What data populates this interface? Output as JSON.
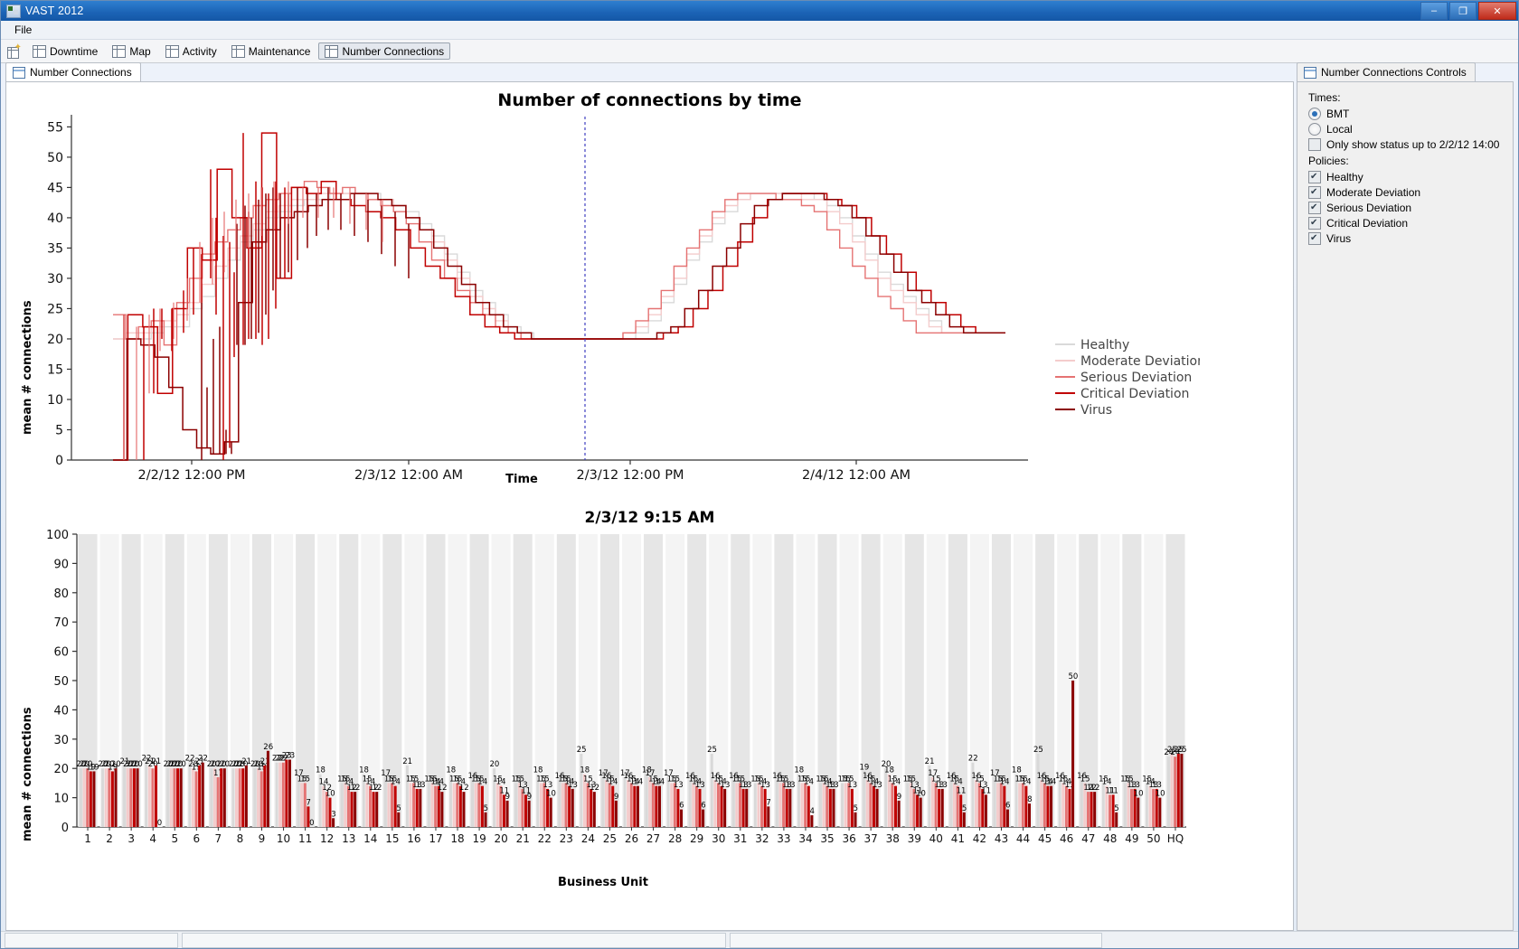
{
  "window": {
    "title": "VAST 2012",
    "title_ghost": "",
    "minimize": "–",
    "maximize": "❐",
    "close": "✕",
    "app_icon": "app-icon"
  },
  "menubar": {
    "items": [
      "File"
    ]
  },
  "perspectives": {
    "new_label": "",
    "items": [
      {
        "label": "Downtime",
        "active": false
      },
      {
        "label": "Map",
        "active": false
      },
      {
        "label": "Activity",
        "active": false
      },
      {
        "label": "Maintenance",
        "active": false
      },
      {
        "label": "Number Connections",
        "active": true
      }
    ]
  },
  "editor": {
    "tab_label": "Number Connections"
  },
  "controls_view": {
    "tab_label": "Number Connections Controls",
    "times_label": "Times:",
    "times_options": [
      {
        "label": "BMT",
        "selected": true
      },
      {
        "label": "Local",
        "selected": false
      }
    ],
    "only_show_label": "Only show status up to 2/2/12 14:00",
    "only_show_checked": false,
    "policies_label": "Policies:",
    "policies": [
      {
        "label": "Healthy",
        "checked": true,
        "color": "#d9d9d9"
      },
      {
        "label": "Moderate Deviation",
        "checked": true,
        "color": "#f2c4c4"
      },
      {
        "label": "Serious Deviation",
        "checked": true,
        "color": "#e08080"
      },
      {
        "label": "Critical Deviation",
        "checked": true,
        "color": "#e00000"
      },
      {
        "label": "Virus",
        "checked": true,
        "color": "#8b0000"
      }
    ]
  },
  "chart_data": [
    {
      "id": "connections_by_time",
      "type": "line",
      "title": "Number of connections by time",
      "xlabel": "Time",
      "ylabel": "mean # connections",
      "ylim": [
        0,
        57
      ],
      "yticks": [
        0,
        5,
        10,
        15,
        20,
        25,
        30,
        35,
        40,
        45,
        50,
        55
      ],
      "xticks": [
        "2/2/12 12:00 PM",
        "2/3/12 12:00 AM",
        "2/3/12 12:00 PM",
        "2/4/12 12:00 AM"
      ],
      "grid": false,
      "legend_position": "right",
      "marker_line": {
        "label": "2/3/12 9:15 AM",
        "color": "#4040c0",
        "style": "dashed"
      },
      "series": [
        {
          "name": "Healthy",
          "color": "#d9d9d9"
        },
        {
          "name": "Moderate Deviation",
          "color": "#f4cccc"
        },
        {
          "name": "Serious Deviation",
          "color": "#e57373"
        },
        {
          "name": "Critical Deviation",
          "color": "#c00000"
        },
        {
          "name": "Virus",
          "color": "#8b0000"
        }
      ],
      "series_values": {
        "Healthy": [
          20,
          20,
          20,
          21,
          22,
          22,
          25,
          27,
          30,
          33,
          36,
          38,
          40,
          41,
          42,
          43,
          43,
          44,
          44,
          44,
          44,
          43,
          42,
          41,
          39,
          37,
          34,
          31,
          28,
          26,
          24,
          22,
          21,
          20,
          20,
          20,
          20,
          20,
          20,
          20,
          20,
          21,
          23,
          26,
          29,
          33,
          36,
          39,
          41,
          43,
          44,
          44,
          44,
          44,
          44,
          43,
          42,
          40,
          37,
          34,
          31,
          29,
          27,
          25,
          23,
          21,
          21,
          21,
          21,
          21
        ],
        "Moderate Deviation": [
          20,
          21,
          21,
          22,
          23,
          24,
          26,
          29,
          32,
          35,
          37,
          39,
          41,
          42,
          43,
          43,
          44,
          44,
          44,
          44,
          43,
          43,
          42,
          40,
          38,
          36,
          33,
          30,
          27,
          25,
          23,
          21,
          20,
          20,
          20,
          20,
          20,
          20,
          20,
          20,
          21,
          22,
          24,
          27,
          30,
          34,
          37,
          40,
          42,
          43,
          44,
          44,
          44,
          44,
          43,
          43,
          41,
          39,
          36,
          33,
          30,
          28,
          26,
          24,
          22,
          21,
          21,
          21,
          21,
          21
        ],
        "Serious Deviation": [
          24,
          20,
          22,
          23,
          19,
          26,
          30,
          34,
          36,
          38,
          40,
          42,
          43,
          44,
          45,
          46,
          45,
          44,
          45,
          44,
          43,
          42,
          41,
          39,
          36,
          33,
          30,
          28,
          26,
          24,
          22,
          21,
          20,
          20,
          20,
          20,
          20,
          20,
          20,
          20,
          21,
          23,
          25,
          28,
          32,
          35,
          38,
          41,
          43,
          44,
          44,
          44,
          43,
          43,
          42,
          41,
          38,
          35,
          32,
          30,
          27,
          25,
          23,
          21,
          21,
          21,
          21,
          21,
          21,
          21
        ],
        "Critical Deviation": [
          0,
          24,
          22,
          11,
          25,
          35,
          33,
          48,
          40,
          35,
          54,
          30,
          45,
          44,
          46,
          43,
          42,
          41,
          40,
          38,
          35,
          32,
          30,
          27,
          24,
          22,
          21,
          20,
          20,
          20,
          20,
          20,
          20,
          20,
          20,
          20,
          20,
          21,
          22,
          25,
          28,
          32,
          36,
          40,
          43,
          44,
          44,
          44,
          43,
          42,
          40,
          37,
          34,
          31,
          28,
          26,
          24,
          22,
          21,
          21
        ],
        "Virus": [
          0,
          20,
          19,
          17,
          12,
          5,
          2,
          1,
          3,
          26,
          36,
          38,
          40,
          41,
          42,
          43,
          43,
          44,
          44,
          43,
          42,
          40,
          38,
          35,
          32,
          29,
          26,
          24,
          22,
          21,
          20,
          20,
          20,
          20,
          20,
          20,
          20,
          20,
          20,
          21,
          22,
          25,
          28,
          32,
          35,
          39,
          42,
          43,
          44,
          44,
          44,
          43,
          42,
          40,
          37,
          34,
          31,
          28,
          26,
          24,
          22,
          21,
          21,
          21
        ]
      }
    },
    {
      "id": "connections_by_business_unit",
      "type": "bar",
      "title": "2/3/12 9:15 AM",
      "xlabel": "Business Unit",
      "ylabel": "mean # connections",
      "ylim": [
        0,
        100
      ],
      "yticks": [
        0,
        10,
        20,
        30,
        40,
        50,
        60,
        70,
        80,
        90,
        100
      ],
      "categories": [
        "1",
        "2",
        "3",
        "4",
        "5",
        "6",
        "7",
        "8",
        "9",
        "10",
        "11",
        "12",
        "13",
        "14",
        "15",
        "16",
        "17",
        "18",
        "19",
        "20",
        "21",
        "22",
        "23",
        "24",
        "25",
        "26",
        "27",
        "28",
        "29",
        "30",
        "31",
        "32",
        "33",
        "34",
        "35",
        "36",
        "37",
        "38",
        "39",
        "40",
        "41",
        "42",
        "43",
        "44",
        "45",
        "46",
        "47",
        "48",
        "49",
        "50",
        "HQ"
      ],
      "series": [
        {
          "name": "Healthy",
          "color": "#d9d9d9"
        },
        {
          "name": "Moderate Deviation",
          "color": "#f4cccc"
        },
        {
          "name": "Serious Deviation",
          "color": "#e57373"
        },
        {
          "name": "Critical Deviation",
          "color": "#c00000"
        },
        {
          "name": "Virus",
          "color": "#8b0000"
        }
      ],
      "groups": [
        {
          "unit": "1",
          "values": [
            20,
            20,
            20,
            19,
            19
          ]
        },
        {
          "unit": "2",
          "values": [
            20,
            20,
            20,
            19,
            20
          ]
        },
        {
          "unit": "3",
          "values": [
            21,
            20,
            20,
            20,
            20
          ]
        },
        {
          "unit": "4",
          "values": [
            22,
            21,
            20,
            21,
            0
          ]
        },
        {
          "unit": "5",
          "values": [
            20,
            20,
            20,
            20,
            20
          ]
        },
        {
          "unit": "6",
          "values": [
            22,
            20,
            19,
            21,
            22
          ]
        },
        {
          "unit": "7",
          "values": [
            20,
            20,
            17,
            20,
            20
          ]
        },
        {
          "unit": "8",
          "values": [
            20,
            20,
            20,
            20,
            21
          ]
        },
        {
          "unit": "9",
          "values": [
            20,
            20,
            19,
            21,
            26
          ]
        },
        {
          "unit": "10",
          "values": [
            22,
            22,
            22,
            23,
            23
          ]
        },
        {
          "unit": "11",
          "values": [
            17,
            15,
            15,
            7,
            0
          ]
        },
        {
          "unit": "12",
          "values": [
            18,
            14,
            12,
            10,
            3
          ]
        },
        {
          "unit": "13",
          "values": [
            15,
            15,
            14,
            12,
            12
          ]
        },
        {
          "unit": "14",
          "values": [
            18,
            15,
            14,
            12,
            12
          ]
        },
        {
          "unit": "15",
          "values": [
            17,
            15,
            15,
            14,
            5
          ]
        },
        {
          "unit": "16",
          "values": [
            21,
            15,
            15,
            13,
            13
          ]
        },
        {
          "unit": "17",
          "values": [
            15,
            15,
            14,
            14,
            12
          ]
        },
        {
          "unit": "18",
          "values": [
            18,
            15,
            15,
            14,
            12
          ]
        },
        {
          "unit": "19",
          "values": [
            16,
            15,
            15,
            14,
            5
          ]
        },
        {
          "unit": "20",
          "values": [
            20,
            15,
            14,
            11,
            9
          ]
        },
        {
          "unit": "21",
          "values": [
            15,
            15,
            13,
            11,
            9
          ]
        },
        {
          "unit": "22",
          "values": [
            18,
            15,
            15,
            13,
            10
          ]
        },
        {
          "unit": "23",
          "values": [
            16,
            15,
            15,
            14,
            13
          ]
        },
        {
          "unit": "24",
          "values": [
            25,
            18,
            15,
            13,
            12
          ]
        },
        {
          "unit": "25",
          "values": [
            17,
            16,
            15,
            14,
            9
          ]
        },
        {
          "unit": "26",
          "values": [
            17,
            16,
            15,
            14,
            14
          ]
        },
        {
          "unit": "27",
          "values": [
            18,
            17,
            15,
            14,
            14
          ]
        },
        {
          "unit": "28",
          "values": [
            17,
            15,
            15,
            13,
            6
          ]
        },
        {
          "unit": "29",
          "values": [
            16,
            15,
            14,
            13,
            6
          ]
        },
        {
          "unit": "30",
          "values": [
            25,
            16,
            15,
            14,
            13
          ]
        },
        {
          "unit": "31",
          "values": [
            16,
            15,
            15,
            13,
            13
          ]
        },
        {
          "unit": "32",
          "values": [
            15,
            15,
            14,
            13,
            7
          ]
        },
        {
          "unit": "33",
          "values": [
            16,
            15,
            15,
            13,
            13
          ]
        },
        {
          "unit": "34",
          "values": [
            18,
            15,
            15,
            14,
            4
          ]
        },
        {
          "unit": "35",
          "values": [
            15,
            15,
            14,
            13,
            13
          ]
        },
        {
          "unit": "36",
          "values": [
            15,
            15,
            15,
            13,
            5
          ]
        },
        {
          "unit": "37",
          "values": [
            19,
            16,
            15,
            14,
            13
          ]
        },
        {
          "unit": "38",
          "values": [
            20,
            18,
            15,
            14,
            9
          ]
        },
        {
          "unit": "39",
          "values": [
            15,
            15,
            13,
            11,
            10
          ]
        },
        {
          "unit": "40",
          "values": [
            21,
            17,
            15,
            13,
            13
          ]
        },
        {
          "unit": "41",
          "values": [
            16,
            15,
            14,
            11,
            5
          ]
        },
        {
          "unit": "42",
          "values": [
            22,
            16,
            15,
            13,
            11
          ]
        },
        {
          "unit": "43",
          "values": [
            17,
            15,
            15,
            14,
            6
          ]
        },
        {
          "unit": "44",
          "values": [
            18,
            15,
            15,
            14,
            8
          ]
        },
        {
          "unit": "45",
          "values": [
            25,
            16,
            15,
            14,
            14
          ]
        },
        {
          "unit": "46",
          "values": [
            16,
            15,
            14,
            13,
            50
          ]
        },
        {
          "unit": "47",
          "values": [
            16,
            15,
            12,
            12,
            12
          ]
        },
        {
          "unit": "48",
          "values": [
            15,
            14,
            11,
            11,
            5
          ]
        },
        {
          "unit": "49",
          "values": [
            15,
            15,
            13,
            13,
            10
          ]
        },
        {
          "unit": "50",
          "values": [
            15,
            14,
            13,
            13,
            10
          ]
        },
        {
          "unit": "HQ",
          "values": [
            24,
            25,
            24,
            25,
            25
          ]
        }
      ]
    }
  ]
}
